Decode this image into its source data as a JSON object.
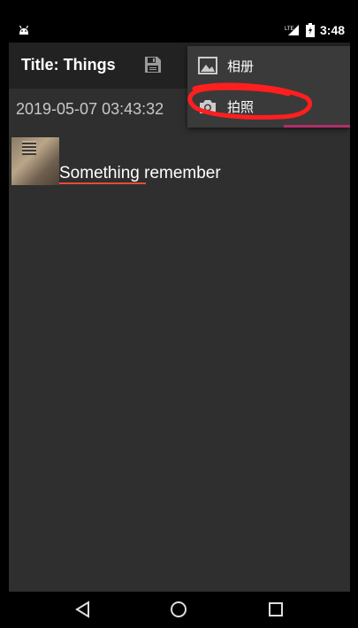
{
  "status_bar": {
    "time": "3:48",
    "network": "LTE",
    "icons": [
      "android-icon",
      "lte-signal-icon",
      "battery-icon"
    ]
  },
  "app_bar": {
    "title": "Title: Things",
    "save_icon": "save-icon"
  },
  "content": {
    "date": "2019-05-07 03:43:32",
    "note": "Something remember",
    "thumbnail": "photo-thumbnail"
  },
  "menu": {
    "items": [
      {
        "label": "相册",
        "icon": "image-icon"
      },
      {
        "label": "拍照",
        "icon": "camera-icon"
      }
    ]
  },
  "nav": {
    "icons": [
      "back-icon",
      "home-icon",
      "recents-icon"
    ]
  },
  "colors": {
    "app_bar": "#222222",
    "content_bg": "#2f2f2f",
    "menu_bg": "#3a3a3a",
    "accent": "#b0306a",
    "annotation": "#ff1f1f"
  }
}
